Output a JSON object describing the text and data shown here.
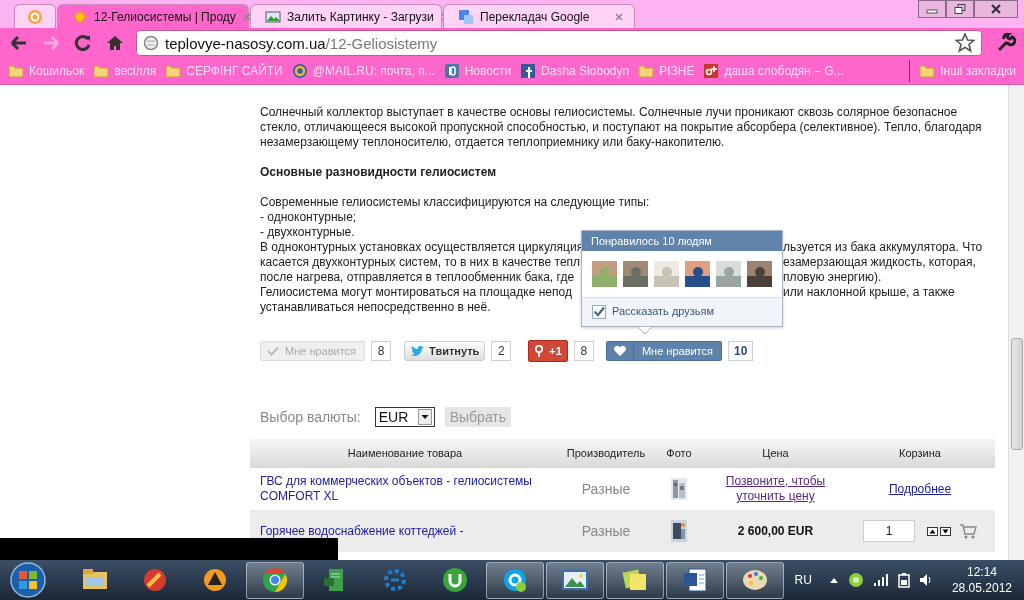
{
  "browser": {
    "tabs": [
      {
        "kind": "pinned",
        "selected": false
      },
      {
        "kind": "page",
        "title": "12-Гелиосистемы | Проду",
        "selected": true
      },
      {
        "kind": "page",
        "title": "Залить Картинку - Загрузи",
        "selected": false
      },
      {
        "kind": "page",
        "title": "Перекладач Google",
        "selected": false
      }
    ],
    "address": {
      "host": "teplovye-nasosy.com.ua",
      "path": "/12-Geliosistemy"
    },
    "bookmarks": [
      {
        "kind": "folder",
        "label": "Кошильок"
      },
      {
        "kind": "folder",
        "label": "весілля"
      },
      {
        "kind": "folder",
        "label": "СЕРФІНГ САЙТИ"
      },
      {
        "kind": "mail",
        "label": "@MAIL.RU: почта, п..."
      },
      {
        "kind": "vk",
        "label": "Новости"
      },
      {
        "kind": "facebook",
        "label": "Dasha Slobodyn"
      },
      {
        "kind": "folder",
        "label": "РІЗНЕ"
      },
      {
        "kind": "gplus",
        "label": "даша слободян – G..."
      }
    ],
    "other_bookmarks": "Інші закладки"
  },
  "article": {
    "paragraph": [
      "Солнечный коллектор выступает в качестве основы гелиосистемы. Солнечные лучи проникают сквозь солярное безопасное",
      "стекло, отличающееся высокой пропускной способностью, и поступают на покрытие абсорбера (селективное). Тепло, благодаря",
      "незамерзающему теплоносителю, отдается теплоприемнику или баку-накопителю."
    ],
    "heading": "Основные разновидности гелиосистем",
    "list_lines": [
      "Современные гелиосистемы классифицируются на следующие типы:",
      "- одноконтурные;",
      "- двухконтурные."
    ],
    "covered_lines": [
      {
        "left": "В одноконтурных установках осуществляется циркуляция",
        "right": "льзуется из бака аккумулятора. Что"
      },
      {
        "left": "касается двухконтурных систем, то в них в качестве тепл",
        "right": "езамерзающая жидкость, которая,"
      },
      {
        "left": "после нагрева, отправляется в теплообменник бака, где",
        "right": "пловую энергию)."
      },
      {
        "left": "Гелиосистема могут монтироваться на площадке непод",
        "right": "или наклонной крыше, а также"
      }
    ],
    "last_line": "устанавливаться непосредственно в неё."
  },
  "social": [
    {
      "kind": "vk",
      "label": "Мне нравится",
      "count": "8",
      "disabled": true
    },
    {
      "kind": "twitter",
      "label": "Твитнуть",
      "count": "2",
      "disabled": false
    },
    {
      "kind": "gplus",
      "label": "+1",
      "count": "8",
      "disabled": false
    },
    {
      "kind": "vk",
      "label": "Мне нравится",
      "count": "10",
      "disabled": false
    }
  ],
  "likes_popup": {
    "title": "Понравилось 10 людям",
    "share": {
      "label": "Рассказать друзьям",
      "checked": true
    }
  },
  "currency": {
    "label": "Выбор валюты:",
    "value": "EUR",
    "button": "Выбрать"
  },
  "table": {
    "columns": [
      "Наименование товара",
      "Производитель",
      "Фото",
      "Цена",
      "Корзина"
    ],
    "rows": [
      {
        "name": "ГВС для коммерческих объектов - гелиосистемы COMFORT XL",
        "maker": "Разные",
        "price": {
          "kind": "link",
          "text": "Позвоните, чтобы уточнить цену"
        },
        "cart": {
          "kind": "link",
          "text": "Подробнее"
        }
      },
      {
        "name": "Горячее водоснабжение коттеджей -",
        "maker": "Разные",
        "price": {
          "kind": "text",
          "text": "2 600,00 EUR"
        },
        "cart": {
          "kind": "quantity",
          "value": "1"
        }
      }
    ]
  },
  "taskbar": {
    "apps": [
      {
        "kind": "explorer",
        "active": false
      },
      {
        "kind": "cleaner",
        "active": false
      },
      {
        "kind": "player",
        "active": false
      },
      {
        "kind": "chrome",
        "active": true
      },
      {
        "kind": "server",
        "active": false
      },
      {
        "kind": "gear",
        "active": false
      },
      {
        "kind": "torrent",
        "active": false
      },
      {
        "kind": "skype",
        "active": true
      },
      {
        "kind": "photos",
        "active": true
      },
      {
        "kind": "notes",
        "active": true
      },
      {
        "kind": "word",
        "active": true
      },
      {
        "kind": "paint",
        "active": true
      }
    ],
    "tray": {
      "language": "RU",
      "time": "12:14",
      "date": "28.05.2012"
    }
  }
}
